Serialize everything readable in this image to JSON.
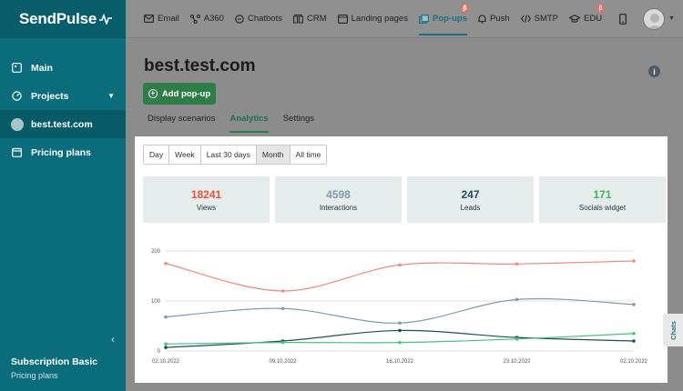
{
  "brand": {
    "name": "SendPulse",
    "pulse_glyph": "⁓"
  },
  "sidebar": {
    "items": [
      {
        "label": "Main",
        "icon": "dashboard-icon"
      },
      {
        "label": "Projects",
        "icon": "projects-icon"
      },
      {
        "label": "best.test.com",
        "icon": "site-avatar"
      },
      {
        "label": "Pricing plans",
        "icon": "calendar-icon"
      }
    ],
    "subscription_title": "Subscription Basic",
    "subscription_link": "Pricing plans"
  },
  "topnav": {
    "items": [
      {
        "label": "Email",
        "icon": "email-icon",
        "badge": ""
      },
      {
        "label": "A360",
        "icon": "a360-icon",
        "badge": ""
      },
      {
        "label": "Chatbots",
        "icon": "chatbot-icon",
        "badge": ""
      },
      {
        "label": "CRM",
        "icon": "crm-icon",
        "badge": ""
      },
      {
        "label": "Landing pages",
        "icon": "landing-icon",
        "badge": ""
      },
      {
        "label": "Pop-ups",
        "icon": "popup-icon",
        "badge": "β"
      },
      {
        "label": "Push",
        "icon": "bell-icon",
        "badge": ""
      },
      {
        "label": "SMTP",
        "icon": "code-icon",
        "badge": ""
      },
      {
        "label": "EDU",
        "icon": "graduation-icon",
        "badge": "β"
      }
    ]
  },
  "main": {
    "title": "best.test.com",
    "add_button": "Add pop-up",
    "tabs": [
      "Display scenarios",
      "Analytics",
      "Settings"
    ]
  },
  "periods": [
    "Day",
    "Week",
    "Last 30 days",
    "Month",
    "All time"
  ],
  "stats": [
    {
      "value": "18241",
      "label": "Views",
      "color": "#e8533b"
    },
    {
      "value": "4598",
      "label": "Interactions",
      "color": "#7f9cb2"
    },
    {
      "value": "247",
      "label": "Leads",
      "color": "#1e4e5c"
    },
    {
      "value": "171",
      "label": "Socials widget",
      "color": "#3cb765"
    }
  ],
  "chats_label": "Chats",
  "colors": {
    "sidebar": "#0b6d7b",
    "accent": "#2e7d48"
  },
  "chart_data": {
    "type": "line",
    "x": [
      "02.10.2022",
      "09.10.2022",
      "16.10.2022",
      "23.10.2022",
      "02.10.2022"
    ],
    "ylim": [
      0,
      200
    ],
    "yticks": [
      0,
      100,
      200
    ],
    "grid": true,
    "series": [
      {
        "values": [
          175,
          120,
          172,
          174,
          180
        ],
        "color": "#f08a7a"
      },
      {
        "values": [
          68,
          85,
          56,
          103,
          93
        ],
        "color": "#7f9cb2"
      },
      {
        "values": [
          7,
          20,
          41,
          27,
          20
        ],
        "color": "#1e4e5c"
      },
      {
        "values": [
          14,
          17,
          17,
          24,
          35
        ],
        "color": "#4ac27a"
      }
    ]
  }
}
